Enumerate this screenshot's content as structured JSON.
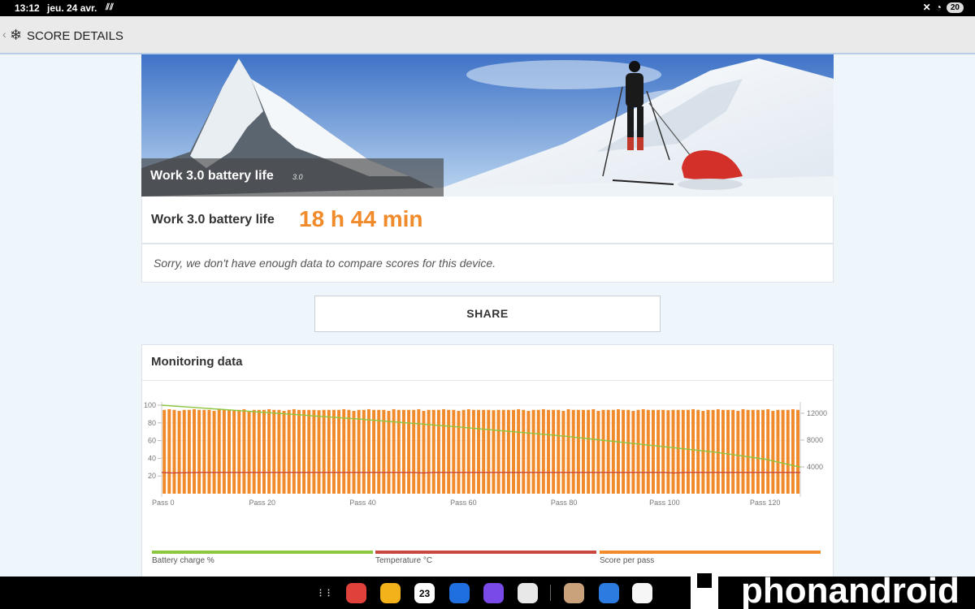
{
  "status": {
    "time": "13:12",
    "date": "jeu. 24 avr.",
    "battery": "20",
    "notif_icon": "signal-icon"
  },
  "appbar": {
    "title": "SCORE DETAILS",
    "back_icon": "chevron-left-icon",
    "logo_icon": "snowflake-icon"
  },
  "hero": {
    "title": "Work 3.0 battery life",
    "version": "3.0"
  },
  "result": {
    "label": "Work 3.0 battery life",
    "value": "18 h 44 min",
    "accent": "#f08a2a"
  },
  "notice": {
    "message": "Sorry, we don't have enough data to compare scores for this device."
  },
  "share": {
    "label": "SHARE"
  },
  "monitor": {
    "title": "Monitoring data"
  },
  "chart_data": {
    "type": "bar",
    "x_ticks": [
      "Pass 0",
      "Pass 20",
      "Pass 40",
      "Pass 60",
      "Pass 80",
      "Pass 100",
      "Pass 120"
    ],
    "x_range": [
      0,
      127
    ],
    "y_left_ticks": [
      "100",
      "80",
      "60",
      "40",
      "20"
    ],
    "y_left_range": [
      0,
      100
    ],
    "y_right_ticks": [
      "12000",
      "8000",
      "4000"
    ],
    "y_right_range": [
      0,
      13200
    ],
    "grid": true,
    "series": [
      {
        "name": "Battery charge %",
        "type": "line",
        "color": "#8dc63f",
        "axis": "left",
        "x": [
          0,
          20,
          40,
          60,
          80,
          100,
          110,
          120,
          127
        ],
        "values": [
          100,
          92,
          84,
          75,
          65,
          53,
          47,
          39,
          30
        ]
      },
      {
        "name": "Temperature °C",
        "type": "line",
        "color": "#c8473f",
        "axis": "left",
        "x": [
          0,
          2,
          8,
          50,
          52,
          54,
          100,
          102,
          104,
          127
        ],
        "values": [
          24,
          23.5,
          24,
          24,
          23.5,
          24,
          24,
          23.5,
          24,
          24
        ]
      },
      {
        "name": "Score per pass",
        "type": "bar",
        "color": "#f08a2a",
        "axis": "right",
        "pass_count": 128,
        "value_typical": 12500
      }
    ]
  },
  "legend": [
    "Battery charge %",
    "Temperature °C",
    "Score per pass"
  ],
  "taskbar": {
    "apps": [
      {
        "name": "grid-icon",
        "color": "#000000"
      },
      {
        "name": "notes-app-icon",
        "color": "#e0413b"
      },
      {
        "name": "files-app-icon",
        "color": "#f3b21a"
      },
      {
        "name": "calendar-app-icon",
        "color": "#ffffff",
        "label": "23"
      },
      {
        "name": "messages-app-icon",
        "color": "#1f6fe0"
      },
      {
        "name": "browser-app-icon",
        "color": "#7a4ae8"
      },
      {
        "name": "camera-app-icon",
        "color": "#e8e8e8"
      },
      {
        "name": "game-app-icon",
        "color": "#c9a27b"
      },
      {
        "name": "car-app-icon",
        "color": "#2b7be0"
      },
      {
        "name": "benchmark-app-icon",
        "color": "#f6f6f6"
      }
    ]
  },
  "watermark": {
    "text": "phonandroid"
  }
}
